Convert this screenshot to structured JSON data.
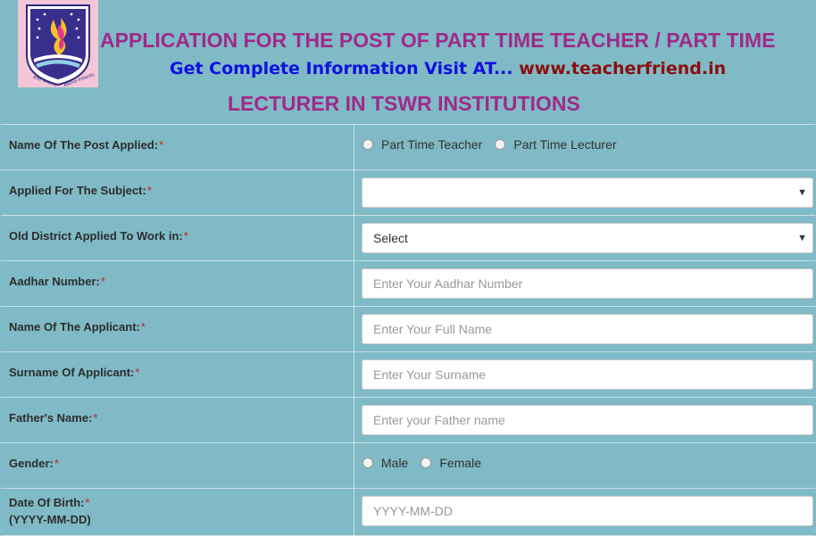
{
  "header": {
    "title_line1": "APPLICATION FOR THE POST OF PART TIME TEACHER / PART TIME",
    "promo_text": "Get Complete Information Visit AT...",
    "promo_url": "www.teacherfriend.in",
    "title_line2": "LECTURER IN TSWR INSTITUTIONS",
    "logo_icon": "tswr-emblem-icon",
    "logo_text_left": "Ano Goava",
    "logo_text_right": "Above Inherits"
  },
  "colors": {
    "background": "#7fbac6",
    "title": "#a0298a",
    "promo_blue": "#1010e0",
    "promo_red": "#8b0e0e",
    "required": "#d02020"
  },
  "required_mark": "*",
  "form": {
    "post": {
      "label": "Name Of The Post Applied:",
      "options": [
        "Part Time Teacher",
        "Part Time Lecturer"
      ]
    },
    "subject": {
      "label": "Applied For The Subject:",
      "value": ""
    },
    "district": {
      "label": "Old District Applied To Work in:",
      "value": "Select"
    },
    "aadhar": {
      "label": "Aadhar Number:",
      "placeholder": "Enter Your Aadhar Number"
    },
    "applicant": {
      "label": "Name Of The Applicant:",
      "placeholder": "Enter Your Full Name"
    },
    "surname": {
      "label": "Surname Of Applicant:",
      "placeholder": "Enter Your Surname"
    },
    "father": {
      "label": "Father's Name:",
      "placeholder": "Enter your Father name"
    },
    "gender": {
      "label": "Gender:",
      "options": [
        "Male",
        "Female"
      ]
    },
    "dob": {
      "label": "Date Of Birth:",
      "sublabel": "(YYYY-MM-DD)",
      "placeholder": "YYYY-MM-DD"
    }
  }
}
